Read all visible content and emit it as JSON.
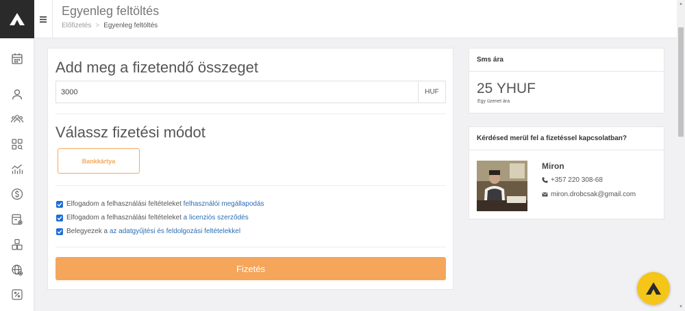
{
  "header": {
    "title": "Egyenleg feltöltés",
    "breadcrumb": {
      "parent": "Előfizetés",
      "separator": ">",
      "current": "Egyenleg feltöltés"
    }
  },
  "sidebar": {
    "items": [
      {
        "icon": "calendar-icon"
      },
      {
        "icon": "user-icon"
      },
      {
        "icon": "users-icon"
      },
      {
        "icon": "grid-search-icon"
      },
      {
        "icon": "analytics-icon"
      },
      {
        "icon": "dollar-circle-icon"
      },
      {
        "icon": "card-settings-icon"
      },
      {
        "icon": "boxes-icon"
      },
      {
        "icon": "globe-icon"
      },
      {
        "icon": "percent-icon"
      }
    ]
  },
  "payment": {
    "amount_title": "Add meg a fizetendő összeget",
    "amount_value": "3000",
    "currency": "HUF",
    "method_title": "Válassz fizetési módot",
    "method_button": "Bankkártya",
    "checks": [
      {
        "text": "Elfogadom a felhasználási feltételeket ",
        "link": "felhasználói megállapodás"
      },
      {
        "text": "Elfogadom a felhasználási feltételeket ",
        "link": "a licenziós szerződés"
      },
      {
        "text": "Belegyezek a ",
        "link": "az adatgyűjtési és feldolgozási feltételekkel"
      }
    ],
    "pay_button": "Fizetés"
  },
  "sms_card": {
    "title": "Sms ára",
    "price": "25 YHUF",
    "subtitle": "Egy üzenet ára"
  },
  "contact_card": {
    "title": "Kérdésed merül fel a fizetéssel kapcsolatban?",
    "name": "Miron",
    "phone": "+357 220 308-68",
    "email": "miron.drobcsak@gmail.com"
  },
  "colors": {
    "accent": "#f5a65b",
    "link": "#2a6db5",
    "checkbox": "#1e6dd5",
    "logo_bg": "#2a2a2a",
    "fab": "#f5c518"
  }
}
